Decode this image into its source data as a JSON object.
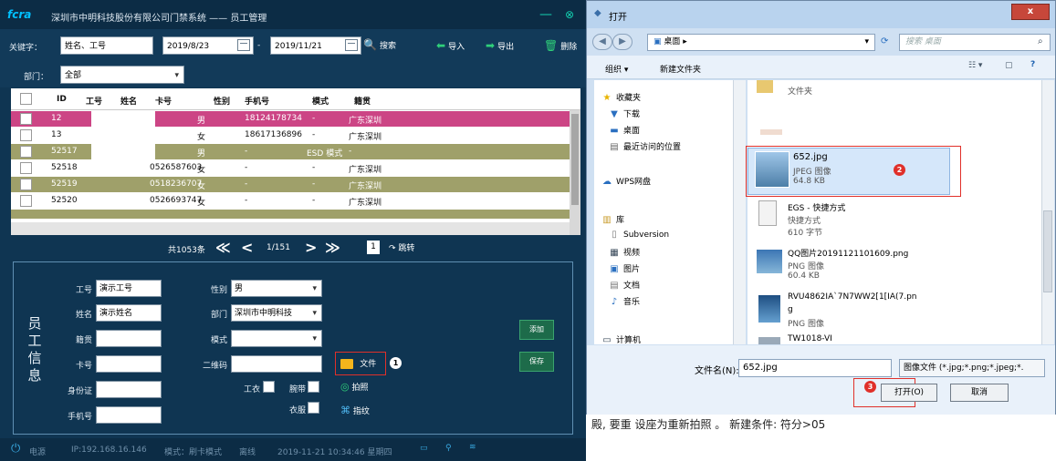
{
  "app": {
    "logo": "fcra",
    "title": "深圳市中明科技股份有限公司门禁系统  ——  员工管理",
    "toolbar": {
      "keyword_label": "关键字：",
      "keyword_value": "姓名、工号",
      "date_from": "2019/8/23",
      "date_sep": "-",
      "date_to": "2019/11/21",
      "search": "搜索",
      "import": "导入",
      "export": "导出",
      "delete": "删除"
    },
    "dept_label": "部门：",
    "dept_value": "全部",
    "table": {
      "headers": [
        "ID",
        "工号",
        "姓名",
        "卡号",
        "性别",
        "手机号",
        "模式",
        "籍贯"
      ],
      "rows": [
        {
          "id": "12",
          "card": "",
          "gender": "男",
          "phone": "18124178734",
          "mode": "-",
          "origin": "广东深圳"
        },
        {
          "id": "13",
          "card": "",
          "gender": "女",
          "phone": "18617136896",
          "mode": "-",
          "origin": "广东深圳"
        },
        {
          "id": "52517",
          "card": "",
          "gender": "男",
          "phone": "-",
          "mode": "ESD 模式",
          "origin": "-"
        },
        {
          "id": "52518",
          "card": "0526587603",
          "gender": "女",
          "phone": "-",
          "mode": "-",
          "origin": "广东深圳"
        },
        {
          "id": "52519",
          "card": "0518236707",
          "gender": "女",
          "phone": "-",
          "mode": "-",
          "origin": "广东深圳"
        },
        {
          "id": "52520",
          "card": "0526693747",
          "gender": "女",
          "phone": "-",
          "mode": "-",
          "origin": "广东深圳"
        }
      ]
    },
    "pager": {
      "total": "共1053条",
      "first": "≪",
      "prev": "<",
      "page": "1/151",
      "next": ">",
      "last": "≫",
      "jump_value": "1",
      "jump": "跳转"
    },
    "panel": {
      "vertical_label": [
        "员",
        "工",
        "信",
        "息"
      ],
      "emp_no_label": "工号",
      "emp_no_value": "演示工号",
      "name_label": "姓名",
      "name_value": "演示姓名",
      "origin_label": "籍贯",
      "card_label": "卡号",
      "id_label": "身份证",
      "phone_label": "手机号",
      "gender_label": "性别",
      "gender_value": "男",
      "dept_label": "部门",
      "dept_value": "深圳市中明科技",
      "mode_label": "模式",
      "qr_label": "二维码",
      "workwear_label": "工衣",
      "wristband_label": "腕带",
      "clothes_label": "衣服",
      "file_button": "文件",
      "photo_button": "拍照",
      "fingerprint_button": "指纹",
      "add_button": "添加",
      "save_button": "保存",
      "marker": "1"
    },
    "status": {
      "power": "电源",
      "ip": "IP:192.168.16.146",
      "mode": "模式：刷卡模式",
      "line": "离线",
      "datetime": "2019-11-21 10:34:46 星期四"
    }
  },
  "dialog": {
    "title": "打开",
    "close": "x",
    "address": "桌面 ▸",
    "search_placeholder": "搜索 桌面",
    "organize": "组织 ▾",
    "new_folder": "新建文件夹",
    "nav": {
      "favorites": "收藏夹",
      "downloads": "下载",
      "desktop": "桌面",
      "recent": "最近访问的位置",
      "wps": "WPS网盘",
      "libraries": "库",
      "subversion": "Subversion",
      "video": "视频",
      "pictures": "图片",
      "documents": "文档",
      "music": "音乐",
      "computer": "计算机"
    },
    "files": [
      {
        "name": "文件夹",
        "type": "",
        "size": ""
      },
      {
        "name": "652.jpg",
        "type": "JPEG 图像",
        "size": "64.8 KB"
      },
      {
        "name": "EGS - 快捷方式",
        "type": "快捷方式",
        "size": "610 字节"
      },
      {
        "name": "QQ图片20191121101609.png",
        "type": "PNG 图像",
        "size": "60.4 KB"
      },
      {
        "name": "RVU4862IA`7N7WW2[1[IA(7.pn",
        "type": "PNG 图像",
        "size": "g"
      },
      {
        "name": "TW1018-VI",
        "type": "",
        "size": ""
      }
    ],
    "filename_label": "文件名(N):",
    "filename_value": "652.jpg",
    "filetype": "图像文件 (*.jpg;*.png;*.jpeg;*.",
    "open_button": "打开(O)",
    "cancel_button": "取消",
    "marker_2": "2",
    "marker_3": "3"
  },
  "background_text": "殿, 要重 设座为重新拍照 。 新建条件: 符分>05"
}
